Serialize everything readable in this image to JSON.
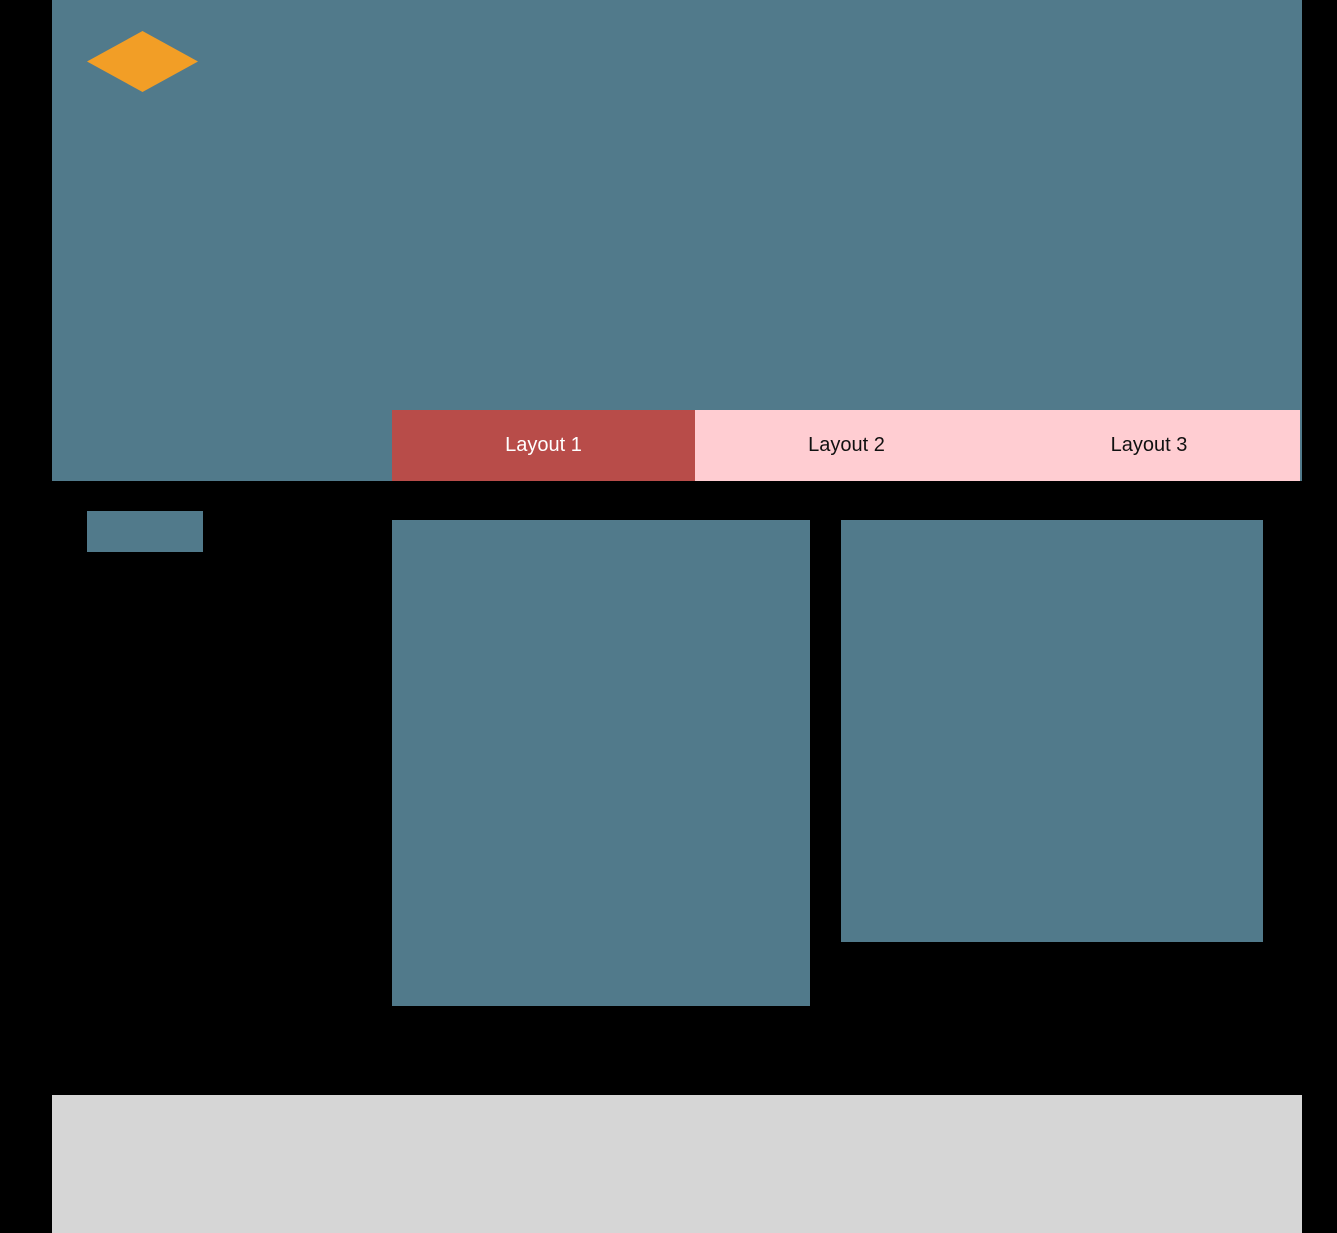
{
  "colors": {
    "background": "#000000",
    "header": "#517a8b",
    "logo": "#f29e26",
    "tab_active": "#b84c49",
    "tab_inactive": "#ffcdd2",
    "panel": "#517a8b",
    "footer": "#d6d6d6"
  },
  "header": {
    "logo_icon": "diamond-logo-icon"
  },
  "tabs": [
    {
      "label": "Layout 1",
      "active": true
    },
    {
      "label": "Layout 2",
      "active": false
    },
    {
      "label": "Layout 3",
      "active": false
    }
  ]
}
